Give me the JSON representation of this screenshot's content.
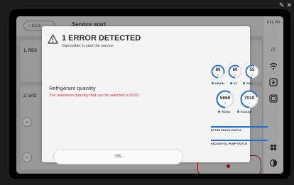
{
  "system": {
    "icons": [
      "edit-square-icon",
      "close-icon"
    ]
  },
  "app": {
    "back_label": "back",
    "title": "Service start",
    "section_1_label": "1. REC",
    "section_2_label": "2. VAC",
    "sidebar_time": "8:50 PM",
    "sidebar_icons": [
      "home-icon",
      "wifi-icon",
      "download-icon",
      "document-icon",
      "grid-icon",
      "contrast-icon"
    ]
  },
  "modal": {
    "title": "1 ERROR DETECTED",
    "subtitle": "Impossible to start the service",
    "field_label": "Refrigerant quantity",
    "error_message": "The maximum quantity that can be selected is 6310",
    "ok_label": "OK",
    "gauges_small": [
      {
        "value": "80",
        "unit": "g",
        "legend": "DRAIN",
        "fill": 0.8
      },
      {
        "value": "60",
        "unit": "g",
        "legend": "UV",
        "fill": 0.6
      },
      {
        "value": "55",
        "unit": "g",
        "legend": "PAG",
        "fill": 0.55
      }
    ],
    "gauges_large": [
      {
        "value": "5860",
        "unit": "g",
        "legend": "R134a",
        "fill": 0.6
      },
      {
        "value": "7010",
        "unit": "g",
        "legend": "R1234yf",
        "fill": 0.7
      }
    ],
    "filter_status_label": "FILTER DRYER STATUS",
    "vacuum_status_label": "VACUUM OIL PUMP STATUS",
    "accent_color": "#1e6fcf",
    "error_color": "#d32f2f"
  }
}
